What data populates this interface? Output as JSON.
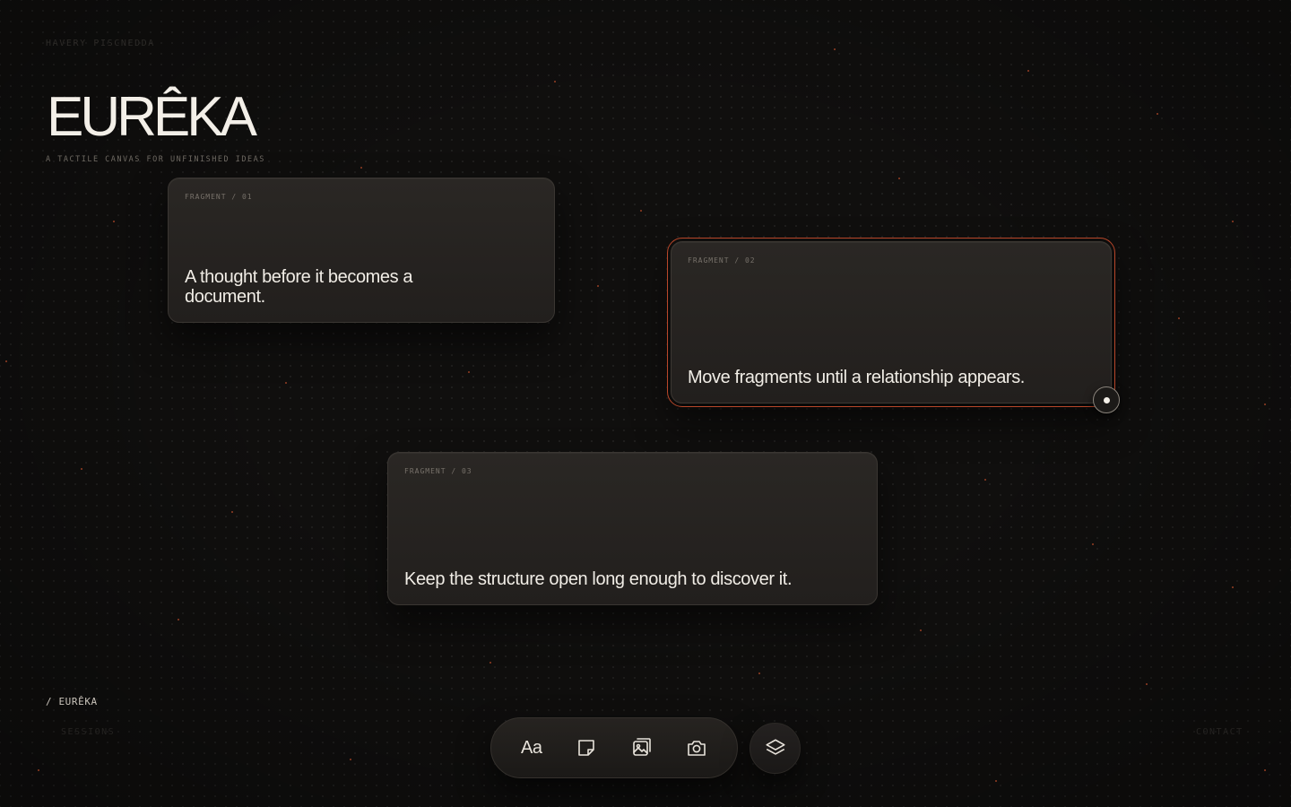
{
  "header": {
    "author": "HAVERY PISCNEDDA",
    "brand": "EURÊKA",
    "tagline": "A TACTILE CANVAS FOR UNFINISHED IDEAS"
  },
  "fragments": [
    {
      "label": "FRAGMENT / 01",
      "text": "A thought before it becomes a document.",
      "selected": false
    },
    {
      "label": "FRAGMENT / 02",
      "text": "Move fragments until a relationship appears.",
      "selected": true
    },
    {
      "label": "FRAGMENT / 03",
      "text": "Keep the structure open long enough to discover it.",
      "selected": false
    }
  ],
  "footer": {
    "breadcrumb": "/ EURÊKA",
    "left_link": "SESSIONS",
    "right_link": "CONTACT"
  },
  "toolbar": {
    "tools": [
      {
        "name": "text-tool",
        "glyph": "Aa"
      },
      {
        "name": "note-tool",
        "icon": "sticky-note-icon"
      },
      {
        "name": "image-tool",
        "icon": "image-icon"
      },
      {
        "name": "camera-tool",
        "icon": "camera-icon"
      }
    ],
    "layers": {
      "icon": "layers-icon"
    }
  },
  "colors": {
    "background": "#100f0e",
    "card": "#262320",
    "accent": "#b8472a",
    "text": "#f1ede6"
  }
}
